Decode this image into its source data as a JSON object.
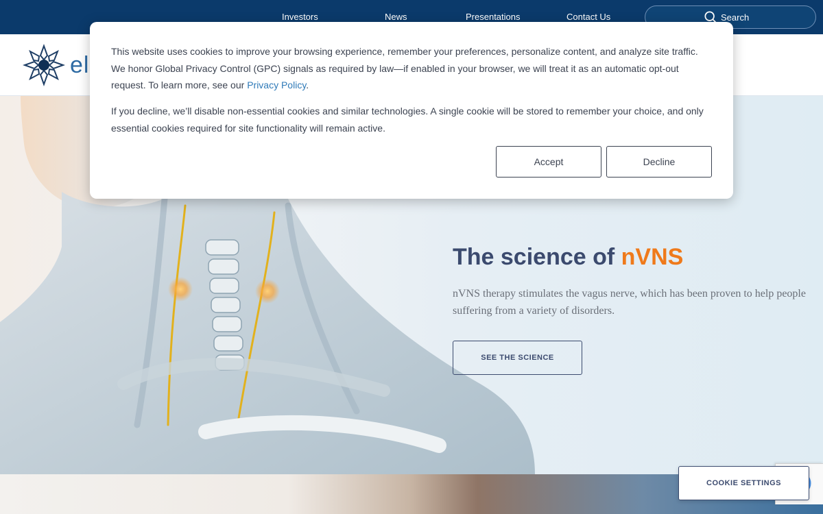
{
  "topnav": {
    "links": [
      "Investors",
      "News",
      "Presentations",
      "Contact Us"
    ],
    "search_label": "Search"
  },
  "header": {
    "logo_text": "ele"
  },
  "hero": {
    "title_main": "The science of ",
    "title_accent": "nVNS",
    "description": "nVNS therapy stimulates the vagus nerve, which has been proven to help people suffering from a variety of disorders.",
    "cta_label": "SEE THE SCIENCE"
  },
  "cookie_modal": {
    "p1_before": "This website uses cookies to improve your browsing experience, remember your preferences, personalize content, and analyze site traffic. We honor Global Privacy Control (GPC) signals as required by law—if enabled in your browser, we will treat it as an automatic opt-out request. To learn more, see our ",
    "privacy_link": "Privacy Policy",
    "p1_after": ".",
    "p2": "If you decline, we’ll disable non-essential cookies and similar technologies. A single cookie will be stored to remember your choice, and only essential cookies required for site functionality will remain active.",
    "accept_label": "Accept",
    "decline_label": "Decline"
  },
  "cookie_settings_label": "COOKIE SETTINGS",
  "colors": {
    "topbar": "#0b3a6b",
    "title": "#3b4a6e",
    "accent": "#ef7a1b",
    "link": "#2f7ab8"
  },
  "icons": {
    "search": "search-icon",
    "logo": "starburst-logo-icon"
  }
}
